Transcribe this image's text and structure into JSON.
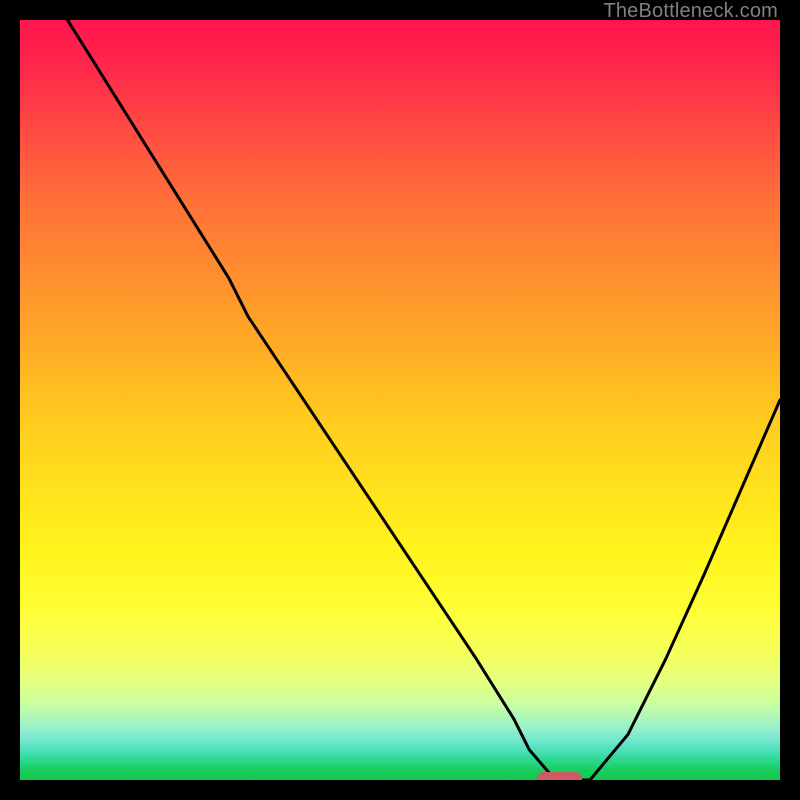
{
  "watermark": "TheBottleneck.com",
  "colors": {
    "frame": "#000000",
    "curve": "#000000",
    "marker": "#cf5a66"
  },
  "chart_data": {
    "type": "line",
    "title": "",
    "xlabel": "",
    "ylabel": "",
    "xlim": [
      0,
      100
    ],
    "ylim": [
      0,
      100
    ],
    "x": [
      0,
      5,
      10,
      15,
      20,
      25,
      27.5,
      30,
      35,
      40,
      45,
      50,
      55,
      60,
      65,
      67,
      70,
      73,
      75,
      80,
      85,
      90,
      95,
      100
    ],
    "values": [
      110,
      102,
      94,
      86,
      78,
      70,
      66,
      61,
      53.5,
      46,
      38.5,
      31,
      23.5,
      16,
      8,
      4,
      0.5,
      0,
      0,
      6,
      16,
      27,
      38.5,
      50
    ],
    "marker": {
      "x_center": 71,
      "y": 0,
      "width_pct": 6
    },
    "note": "x is horizontal position in % of plot width; values are vertical position in % from bottom (100 = top, 0 = bottom). Curve descends from top-left with a slope change near x≈27, reaches a flat minimum around x≈67–73 coinciding with the red pill marker sitting on the green band, then rises toward the right edge."
  }
}
